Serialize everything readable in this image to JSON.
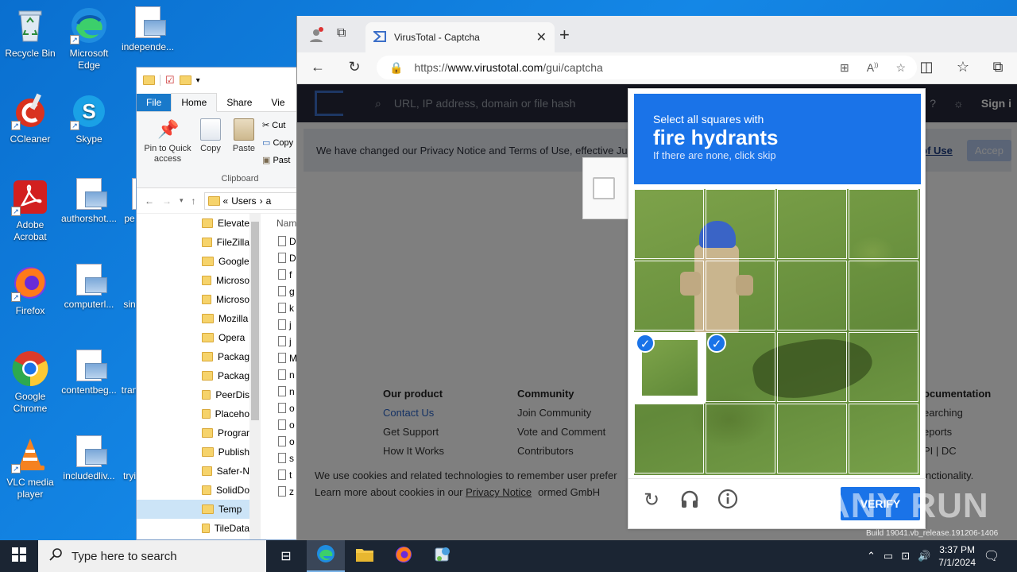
{
  "desktop": {
    "icons": [
      {
        "label": "Recycle Bin"
      },
      {
        "label": "Microsoft Edge"
      },
      {
        "label": "independe..."
      },
      {
        "label": "CCleaner"
      },
      {
        "label": "Skype"
      },
      {
        "label": "Adobe Acrobat"
      },
      {
        "label": "authorshot...."
      },
      {
        "label": "pe"
      },
      {
        "label": "Firefox"
      },
      {
        "label": "computerl..."
      },
      {
        "label": "sin"
      },
      {
        "label": "Google Chrome"
      },
      {
        "label": "contentbeg..."
      },
      {
        "label": "tran"
      },
      {
        "label": "VLC media player"
      },
      {
        "label": "includedliv..."
      },
      {
        "label": "tryi"
      }
    ]
  },
  "explorer": {
    "tabs": [
      "File",
      "Home",
      "Share",
      "Vie"
    ],
    "ribbon": {
      "pin": "Pin to Quick access",
      "copy": "Copy",
      "paste": "Paste",
      "cut": "Cut",
      "copy_path": "Copy",
      "paste_shortcut": "Past",
      "group": "Clipboard"
    },
    "path_prefix": "«",
    "path_users": "Users",
    "path_next": "a",
    "column_name": "Nam",
    "nav_items": [
      "Elevate",
      "FileZilla",
      "Google",
      "Microso",
      "Microso",
      "Mozilla",
      "Opera",
      "Packag",
      "Packag",
      "PeerDis",
      "Placeho",
      "Prograr",
      "Publish",
      "Safer-N",
      "SolidDo",
      "Temp",
      "TileData"
    ],
    "files": [
      "D",
      "D",
      "f",
      "g",
      "k",
      "j",
      "j",
      "M",
      "n",
      "n",
      "o",
      "o",
      "o",
      "s",
      "t",
      "z"
    ]
  },
  "browser": {
    "tab_title": "VirusTotal - Captcha",
    "url_prefix": "https://",
    "url_domain": "www.virustotal.com",
    "url_path": "/gui/captcha",
    "search_placeholder": "URL, IP address, domain or file hash",
    "sign_in": "Sign i",
    "notice": "We have changed our Privacy Notice and Terms of Use, effective Ju",
    "notice_link": "s of Use",
    "accept": "Accep",
    "footer": {
      "col1_head": "Our product",
      "col1_items": [
        "Contact Us",
        "Get Support",
        "How It Works"
      ],
      "col2_head": "Community",
      "col2_items": [
        "Join Community",
        "Vote and Comment",
        "Contributors"
      ],
      "col3_head": "ocumentation",
      "col3_items": [
        "earching",
        "eports",
        "PI | DC"
      ]
    },
    "cookie_line1": "We use cookies and related technologies to remember user prefer",
    "cookie_line1_end": "functionality.",
    "cookie_line2": "Learn more about cookies in our",
    "cookie_link": "Privacy Notice",
    "cookie_line2_end": "ormed GmbH"
  },
  "captcha": {
    "line1": "Select all squares with",
    "object": "fire hydrants",
    "line3": "If there are none, click skip",
    "verify": "VERIFY",
    "selected_tiles": [
      [
        2,
        0
      ],
      [
        2,
        1
      ]
    ]
  },
  "watermark": "ANY RUN",
  "build": "Build 19041.vb_release.191206-1406",
  "taskbar": {
    "search_placeholder": "Type here to search",
    "time": "3:37 PM",
    "date": "7/1/2024"
  },
  "colors": {
    "captcha_blue": "#1a73e8",
    "taskbar": "#1b2533",
    "desktop": "#0b74d4"
  }
}
